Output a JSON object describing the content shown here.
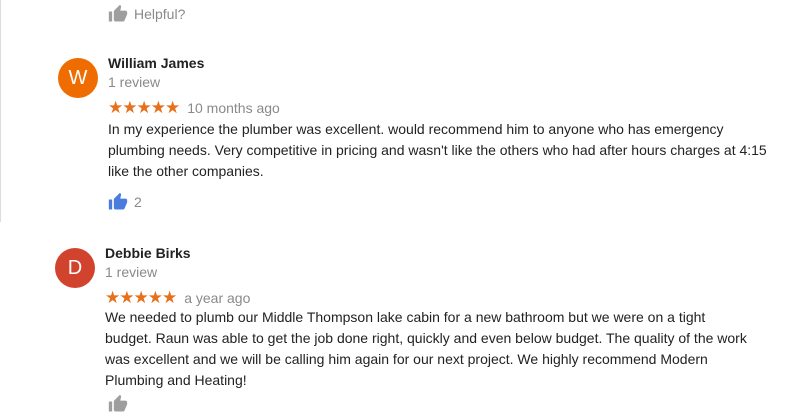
{
  "top": {
    "helpful_label": "Helpful?"
  },
  "reviews": [
    {
      "initial": "W",
      "avatar_color": "#ef6c00",
      "name": "William James",
      "count": "1 review",
      "stars": "★★★★★",
      "time": "10 months ago",
      "text": "In my experience the plumber was excellent. would recommend him to anyone who has emergency plumbing needs. Very competitive in pricing and wasn't like the others who had after hours charges at 4:15 like the other companies.",
      "likes": "2"
    },
    {
      "initial": "D",
      "avatar_color": "#d2432e",
      "name": "Debbie Birks",
      "count": "1 review",
      "stars": "★★★★★",
      "time": "a year ago",
      "text": "We needed to plumb our Middle Thompson lake cabin for a new bathroom but we were on a tight budget.  Raun was able to get the job done right, quickly and even below budget.  The quality of the work was excellent and we will be calling him again for our next project.  We highly recommend Modern Plumbing and Heating!"
    }
  ],
  "colors": {
    "star": "#e7711b",
    "thumb_active": "#4a7ce0",
    "thumb_inactive": "#9e9e9e"
  },
  "icons": {
    "helpful": "thumbs-up-icon",
    "like": "thumbs-up-icon"
  }
}
